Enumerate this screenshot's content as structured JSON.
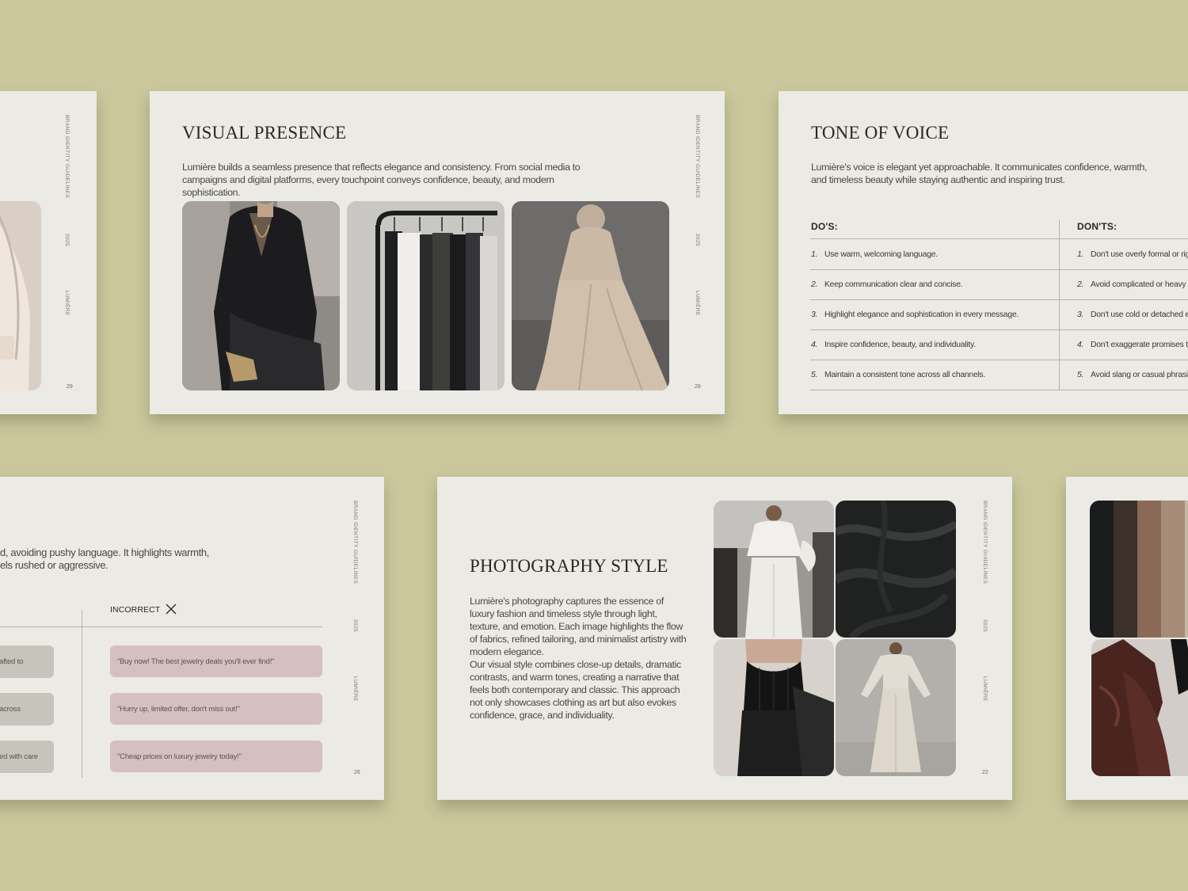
{
  "sidebar": {
    "guidelines": "BRAND IDENTITY GUIDELINES",
    "year": "2025",
    "brand": "LUMIÈRE"
  },
  "slide_29": {
    "page": "29"
  },
  "visual_presence": {
    "title": "VISUAL PRESENCE",
    "text": "Lumière builds a seamless presence that reflects elegance and consistency. From social media to campaigns and digital platforms, every touchpoint conveys confidence, beauty, and modern sophistication.",
    "page": "28"
  },
  "tone_of_voice": {
    "title": "TONE OF VOICE",
    "text": "Lumière's voice is elegant yet approachable. It communicates confidence, warmth, and timeless beauty while staying authentic and inspiring trust.",
    "dos_heading": "DO'S:",
    "donts_heading": "DON'TS:",
    "dos": [
      {
        "num": "1.",
        "text": "Use warm, welcoming language."
      },
      {
        "num": "2.",
        "text": "Keep communication clear and concise."
      },
      {
        "num": "3.",
        "text": "Highlight elegance and sophistication in every message."
      },
      {
        "num": "4.",
        "text": "Inspire confidence, beauty, and individuality."
      },
      {
        "num": "5.",
        "text": "Maintain a consistent tone across all channels."
      }
    ],
    "donts": [
      {
        "num": "1.",
        "text": "Don't use overly formal or rigi"
      },
      {
        "num": "2.",
        "text": "Avoid complicated or heavy"
      },
      {
        "num": "3.",
        "text": "Don't use cold or detached ex"
      },
      {
        "num": "4.",
        "text": "Don't exaggerate promises the"
      },
      {
        "num": "5.",
        "text": "Avoid slang or casual phrasing"
      }
    ]
  },
  "messaging": {
    "text_line1": "d, avoiding pushy language. It highlights warmth,",
    "text_line2": "els rushed or aggressive.",
    "incorrect_label": "INCORRECT",
    "correct_examples": [
      "afted to",
      "across",
      "ed with care"
    ],
    "incorrect_examples": [
      "\"Buy now! The best jewelry deals you'll ever find!\"",
      "\"Hurry up, limited offer, don't miss out!\"",
      "\"Cheap prices on luxury jewelry today!\""
    ],
    "page": "26"
  },
  "photography_style": {
    "title": "PHOTOGRAPHY STYLE",
    "text1": "Lumière's photography captures the essence of luxury fashion and timeless style through light, texture, and emotion. Each image highlights the flow of fabrics, refined tailoring, and minimalist artistry with modern elegance.",
    "text2": "Our visual style combines close-up details, dramatic contrasts, and warm tones, creating a narrative that feels both contemporary and classic. This approach not only showcases clothing as art but also evokes confidence, grace, and individuality.",
    "page": "22"
  },
  "colors": {
    "background": "#c9c79b",
    "slide": "#ebeae4",
    "pill_grey": "#c7c4bc",
    "pill_pink": "#d5c0bf"
  }
}
